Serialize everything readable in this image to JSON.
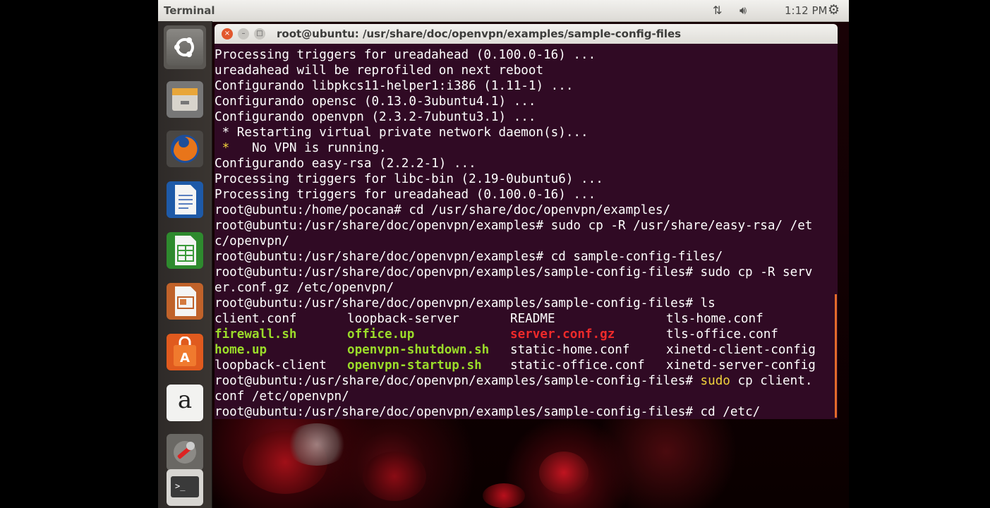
{
  "panel": {
    "title": "Terminal",
    "network_icon": "network-arrows-icon",
    "volume_icon": "speaker-icon",
    "clock": "1:12 PM",
    "settings_icon": "gear-icon"
  },
  "launcher": {
    "items": [
      {
        "name": "dash-home",
        "icon": "ubuntu-logo-icon"
      },
      {
        "name": "files",
        "icon": "file-cabinet-icon"
      },
      {
        "name": "firefox",
        "icon": "firefox-icon"
      },
      {
        "name": "libreoffice-writer",
        "icon": "writer-document-icon"
      },
      {
        "name": "libreoffice-calc",
        "icon": "calc-spreadsheet-icon"
      },
      {
        "name": "libreoffice-impress",
        "icon": "impress-presentation-icon"
      },
      {
        "name": "software-center",
        "icon": "shopping-bag-icon"
      },
      {
        "name": "amazon",
        "icon": "amazon-icon"
      },
      {
        "name": "system-settings",
        "icon": "wrench-icon"
      },
      {
        "name": "terminal",
        "icon": "terminal-icon"
      }
    ],
    "amazon_letter": "a"
  },
  "window": {
    "title": "root@ubuntu: /usr/share/doc/openvpn/examples/sample-config-files",
    "close": "×",
    "minimize": "–",
    "maximize": "□"
  },
  "terminal": {
    "lines": [
      "Processing triggers for ureadahead (0.100.0-16) ...",
      "ureadahead will be reprofiled on next reboot",
      "Configurando libpkcs11-helper1:i386 (1.11-1) ...",
      "Configurando opensc (0.13.0-3ubuntu4.1) ...",
      "Configurando openvpn (2.3.2-7ubuntu3.1) ...",
      " * Restarting virtual private network daemon(s)...",
      "   No VPN is running.",
      "Configurando easy-rsa (2.2.2-1) ...",
      "Processing triggers for libc-bin (2.19-0ubuntu6) ...",
      "Processing triggers for ureadahead (0.100.0-16) ...",
      "root@ubuntu:/home/pocana# cd /usr/share/doc/openvpn/examples/",
      "root@ubuntu:/usr/share/doc/openvpn/examples# sudo cp -R /usr/share/easy-rsa/ /et",
      "c/openvpn/",
      "root@ubuntu:/usr/share/doc/openvpn/examples# cd sample-config-files/",
      "root@ubuntu:/usr/share/doc/openvpn/examples/sample-config-files# sudo cp -R serv",
      "er.conf.gz /etc/openvpn/",
      "root@ubuntu:/usr/share/doc/openvpn/examples/sample-config-files# ls"
    ],
    "star": "*",
    "no_vpn": "   No VPN is running.",
    "ls_rows": [
      [
        "client.conf",
        "loopback-server",
        "README",
        "tls-home.conf"
      ],
      [
        "firewall.sh",
        "office.up",
        "server.conf.gz",
        "tls-office.conf"
      ],
      [
        "home.up",
        "openvpn-shutdown.sh",
        "static-home.conf",
        "xinetd-client-config"
      ],
      [
        "loopback-client",
        "openvpn-startup.sh",
        "static-office.conf",
        "xinetd-server-config"
      ]
    ],
    "prompt": "root@ubuntu:/usr/share/doc/openvpn/examples/sample-config-files# ",
    "cmd1_sudo": "sudo",
    "cmd1_rest": " cp client.",
    "cmd1_cont": "conf /etc/openvpn/",
    "cmd2": "cd /etc/"
  },
  "colors": {
    "terminal_bg": "#300a24",
    "executable": "#9bdc2a",
    "archive": "#ef2a2a",
    "highlight": "#f2d33c"
  }
}
